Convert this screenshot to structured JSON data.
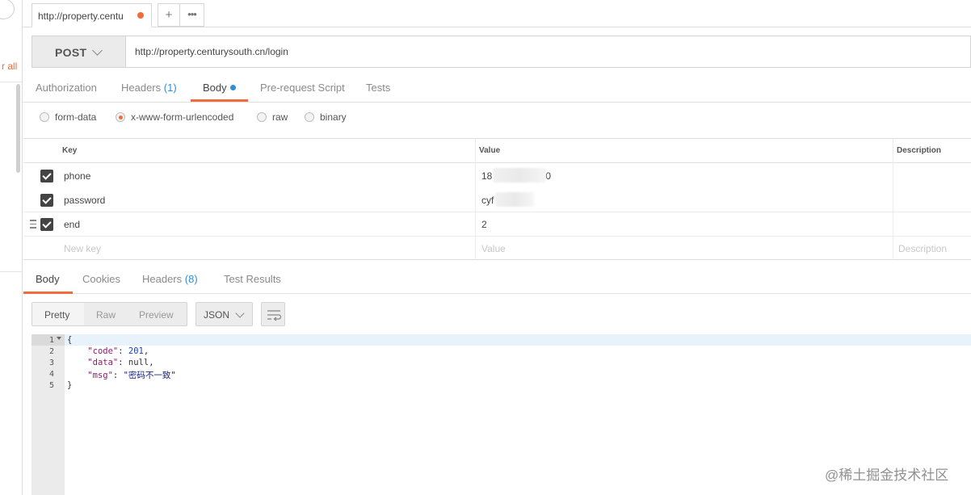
{
  "sidebar": {
    "partial_label": "r all"
  },
  "tabs": {
    "active_tab_title": "http://property.centu",
    "add_label": "+",
    "more_label": "•••"
  },
  "request": {
    "method": "POST",
    "url": "http://property.centurysouth.cn/login"
  },
  "request_tabs": [
    {
      "label": "Authorization"
    },
    {
      "label": "Headers",
      "count": "(1)"
    },
    {
      "label": "Body",
      "active": true
    },
    {
      "label": "Pre-request Script"
    },
    {
      "label": "Tests"
    }
  ],
  "body_modes": [
    {
      "label": "form-data",
      "selected": false
    },
    {
      "label": "x-www-form-urlencoded",
      "selected": true
    },
    {
      "label": "raw",
      "selected": false
    },
    {
      "label": "binary",
      "selected": false
    }
  ],
  "kv_table": {
    "headers": {
      "key": "Key",
      "value": "Value",
      "description": "Description"
    },
    "rows": [
      {
        "key": "phone",
        "value": "18",
        "value_tail": "0",
        "checked": true
      },
      {
        "key": "password",
        "value": "cyf",
        "checked": true
      },
      {
        "key": "end",
        "value": "2",
        "checked": true
      }
    ],
    "placeholders": {
      "key": "New key",
      "value": "Value",
      "description": "Description"
    }
  },
  "response_tabs": [
    {
      "label": "Body",
      "active": true
    },
    {
      "label": "Cookies"
    },
    {
      "label": "Headers",
      "count": "(8)"
    },
    {
      "label": "Test Results"
    }
  ],
  "response_toolbar": {
    "views": [
      "Pretty",
      "Raw",
      "Preview"
    ],
    "format": "JSON"
  },
  "response_body": {
    "line_numbers": [
      "1",
      "2",
      "3",
      "4",
      "5"
    ],
    "open_brace": "{",
    "lines": [
      {
        "key": "\"code\"",
        "value": "201",
        "type": "num",
        "trail": ","
      },
      {
        "key": "\"data\"",
        "value": "null",
        "type": "nul",
        "trail": ","
      },
      {
        "key": "\"msg\"",
        "value": "\"密码不一致\"",
        "type": "str",
        "trail": ""
      }
    ],
    "close_brace": "}"
  },
  "watermark": "@稀土掘金技术社区",
  "colors": {
    "accent": "#f26b3a",
    "link": "#2f8fd6"
  }
}
